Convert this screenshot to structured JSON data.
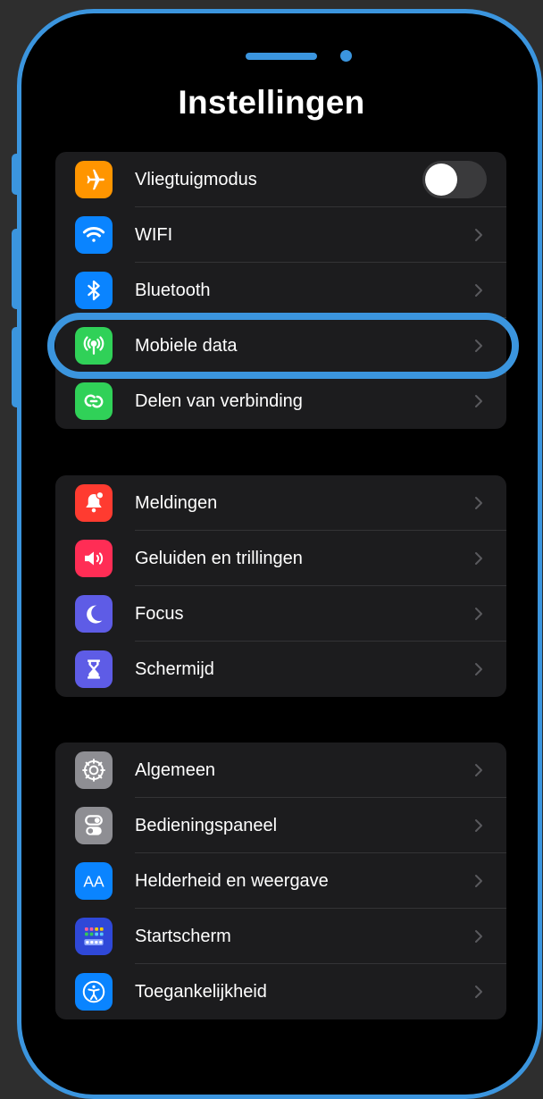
{
  "screen": {
    "title": "Instellingen"
  },
  "groups": [
    {
      "items": [
        {
          "label": "Vliegtuigmodus",
          "icon": "airplane-icon",
          "icon_color": "#ff9500",
          "control": "toggle",
          "toggle_on": false
        },
        {
          "label": "WIFI",
          "icon": "wifi-icon",
          "icon_color": "#0a84ff",
          "control": "chevron"
        },
        {
          "label": "Bluetooth",
          "icon": "bluetooth-icon",
          "icon_color": "#0a84ff",
          "control": "chevron"
        },
        {
          "label": "Mobiele data",
          "icon": "antenna-icon",
          "icon_color": "#30d158",
          "control": "chevron",
          "highlighted": true
        },
        {
          "label": "Delen van verbinding",
          "icon": "link-icon",
          "icon_color": "#30d158",
          "control": "chevron"
        }
      ]
    },
    {
      "items": [
        {
          "label": "Meldingen",
          "icon": "bell-icon",
          "icon_color": "#ff3b30",
          "control": "chevron"
        },
        {
          "label": "Geluiden en trillingen",
          "icon": "speaker-icon",
          "icon_color": "#ff2d55",
          "control": "chevron"
        },
        {
          "label": "Focus",
          "icon": "moon-icon",
          "icon_color": "#5e5ce6",
          "control": "chevron"
        },
        {
          "label": "Schermijd",
          "icon": "hourglass-icon",
          "icon_color": "#5e5ce6",
          "control": "chevron"
        }
      ]
    },
    {
      "items": [
        {
          "label": "Algemeen",
          "icon": "gear-icon",
          "icon_color": "#8e8e93",
          "control": "chevron"
        },
        {
          "label": "Bedieningspaneel",
          "icon": "switches-icon",
          "icon_color": "#8e8e93",
          "control": "chevron"
        },
        {
          "label": "Helderheid en weergave",
          "icon": "text-size-icon",
          "icon_color": "#0a84ff",
          "control": "chevron"
        },
        {
          "label": "Startscherm",
          "icon": "home-grid-icon",
          "icon_color": "#2f48d8",
          "control": "chevron"
        },
        {
          "label": "Toegankelijkheid",
          "icon": "accessibility-icon",
          "icon_color": "#0a84ff",
          "control": "chevron"
        }
      ]
    }
  ],
  "colors": {
    "frame_accent": "#3b95de",
    "group_background": "#1c1c1e",
    "screen_background": "#000000"
  }
}
